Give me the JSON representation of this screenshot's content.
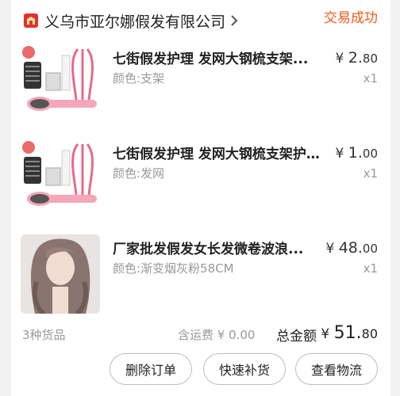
{
  "header": {
    "shop_icon": "shop-icon",
    "shop_name": "义乌市亚尔娜假发有限公司",
    "chevron": "chevron-right-icon",
    "status": "交易成功"
  },
  "items": [
    {
      "title": "七街假发护理 发网大钢梳支架...",
      "variant": "颜色:支架",
      "price_symbol": "¥",
      "price_int": "2.",
      "price_dec": "80",
      "qty": "x1"
    },
    {
      "title": "七街假发护理 发网大钢梳支架护...",
      "variant": "颜色:发网",
      "price_symbol": "¥",
      "price_int": "1.",
      "price_dec": "00",
      "qty": "x1"
    },
    {
      "title": "厂家批发假发女长发微卷波浪...",
      "variant": "颜色:渐变烟灰粉58CM",
      "price_symbol": "¥",
      "price_int": "48.",
      "price_dec": "00",
      "qty": "x1"
    }
  ],
  "summary": {
    "count": "3种货品",
    "shipping": "含运费 ¥ 0.00",
    "total_label": "总金额",
    "total_symbol": "¥",
    "total_int": "51.",
    "total_dec": "80"
  },
  "actions": {
    "delete": "删除订单",
    "restock": "快速补货",
    "logistics": "查看物流"
  },
  "colors": {
    "accent": "#f25a1d",
    "brand_red": "#e3322d",
    "pink": "#f4a7b9"
  }
}
